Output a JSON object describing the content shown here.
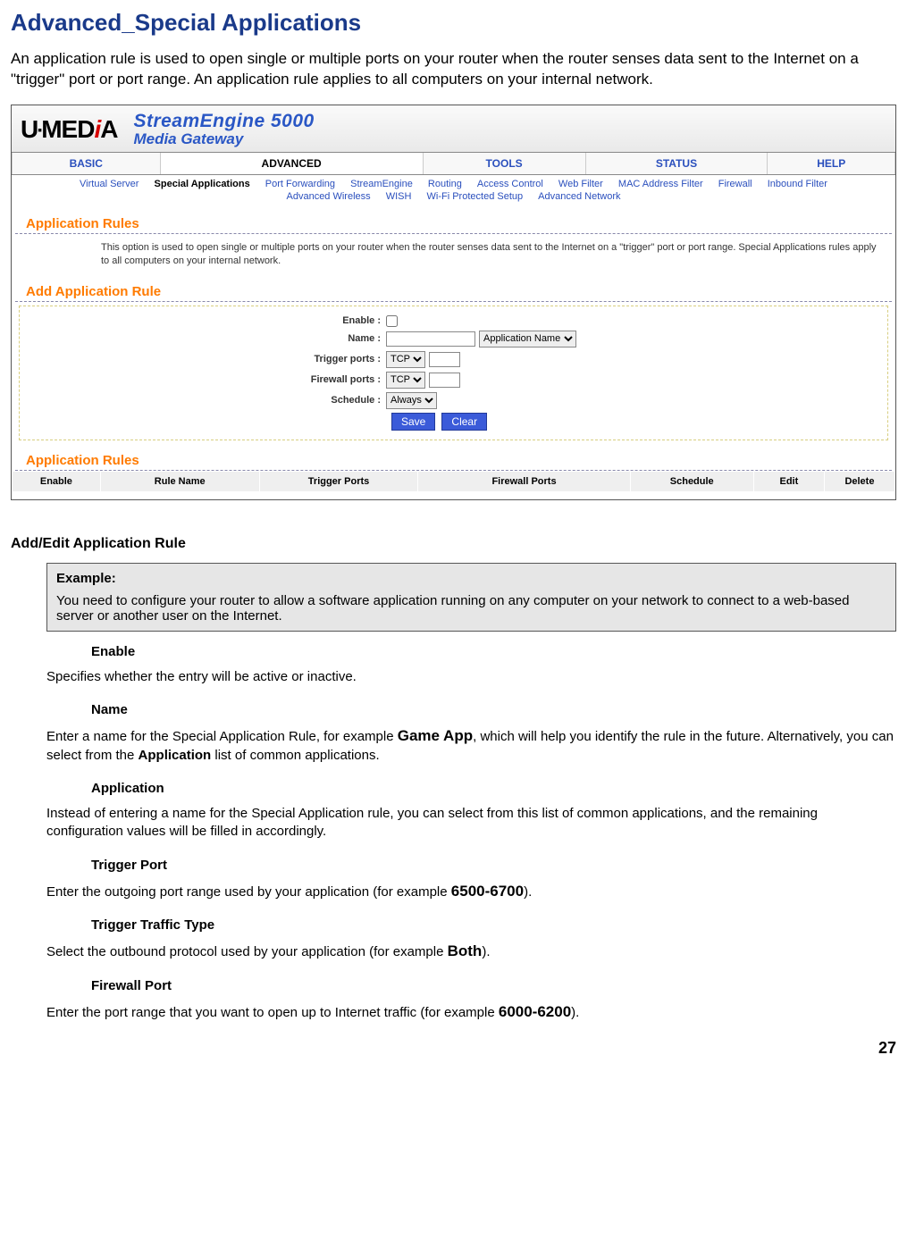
{
  "page": {
    "title": "Advanced_Special Applications",
    "intro": "An application rule is used to open single or multiple ports on your router when the router senses data sent to the Internet on a \"trigger\" port or port range. An application rule applies to all computers on your internal network.",
    "page_number": "27"
  },
  "router": {
    "logo_left": "U",
    "logo_sep": "•",
    "logo_mid": "MED",
    "logo_i": "i",
    "logo_end": "A",
    "product_line1": "StreamEngine 5000",
    "product_line2": "Media Gateway",
    "tabs": {
      "basic": "BASIC",
      "advanced": "ADVANCED",
      "tools": "TOOLS",
      "status": "STATUS",
      "help": "HELP"
    },
    "subnav": {
      "virtual_server": "Virtual Server",
      "special_apps": "Special Applications",
      "port_forwarding": "Port Forwarding",
      "streamengine": "StreamEngine",
      "routing": "Routing",
      "access_control": "Access Control",
      "web_filter": "Web Filter",
      "mac_filter": "MAC Address Filter",
      "firewall": "Firewall",
      "inbound_filter": "Inbound Filter",
      "adv_wireless": "Advanced Wireless",
      "wish": "WISH",
      "wps": "Wi-Fi Protected Setup",
      "adv_network": "Advanced Network"
    },
    "section1_title": "Application Rules",
    "section1_desc": "This option is used to open single or multiple ports on your router when the router senses data sent to the Internet on a \"trigger\" port or port range. Special Applications rules apply to all computers on your internal network.",
    "section2_title": "Add Application Rule",
    "form": {
      "enable_label": "Enable :",
      "name_label": "Name :",
      "name_value": "",
      "appname_select": "Application Name",
      "trigger_label": "Trigger ports :",
      "trigger_proto": "TCP",
      "trigger_value": "",
      "firewall_label": "Firewall ports :",
      "firewall_proto": "TCP",
      "firewall_value": "",
      "schedule_label": "Schedule :",
      "schedule_value": "Always",
      "save_btn": "Save",
      "clear_btn": "Clear"
    },
    "section3_title": "Application Rules",
    "table_headers": {
      "enable": "Enable",
      "rule_name": "Rule Name",
      "trigger_ports": "Trigger Ports",
      "firewall_ports": "Firewall Ports",
      "schedule": "Schedule",
      "edit": "Edit",
      "delete": "Delete"
    }
  },
  "doc": {
    "subhead": "Add/Edit Application Rule",
    "example_title": "Example:",
    "example_body": "You need to configure your router to allow a software application running on any computer on your network to connect to a web-based server or another user on the Internet.",
    "f_enable_h": "Enable",
    "f_enable_d": "Specifies whether the entry will be active or inactive.",
    "f_name_h": "Name",
    "f_name_d1": "Enter a name for the Special Application Rule, for example ",
    "f_name_bold": "Game App",
    "f_name_d2": ", which will help you identify the rule in the future. Alternatively, you can select from the ",
    "f_name_bold2": "Application",
    "f_name_d3": " list of common applications.",
    "f_app_h": "Application",
    "f_app_d": "Instead of entering a name for the Special Application rule, you can select from this list of common applications, and the remaining configuration values will be filled in accordingly.",
    "f_tport_h": "Trigger Port",
    "f_tport_d1": "Enter the outgoing port range used by your application (for example ",
    "f_tport_bold": "6500-6700",
    "f_tport_d2": ").",
    "f_ttype_h": "Trigger Traffic Type",
    "f_ttype_d1": "Select the outbound protocol used by your application (for example ",
    "f_ttype_bold": "Both",
    "f_ttype_d2": ").",
    "f_fport_h": "Firewall Port",
    "f_fport_d1": "Enter the port range that you want to open up to Internet traffic (for example ",
    "f_fport_bold": "6000-6200",
    "f_fport_d2": ")."
  }
}
